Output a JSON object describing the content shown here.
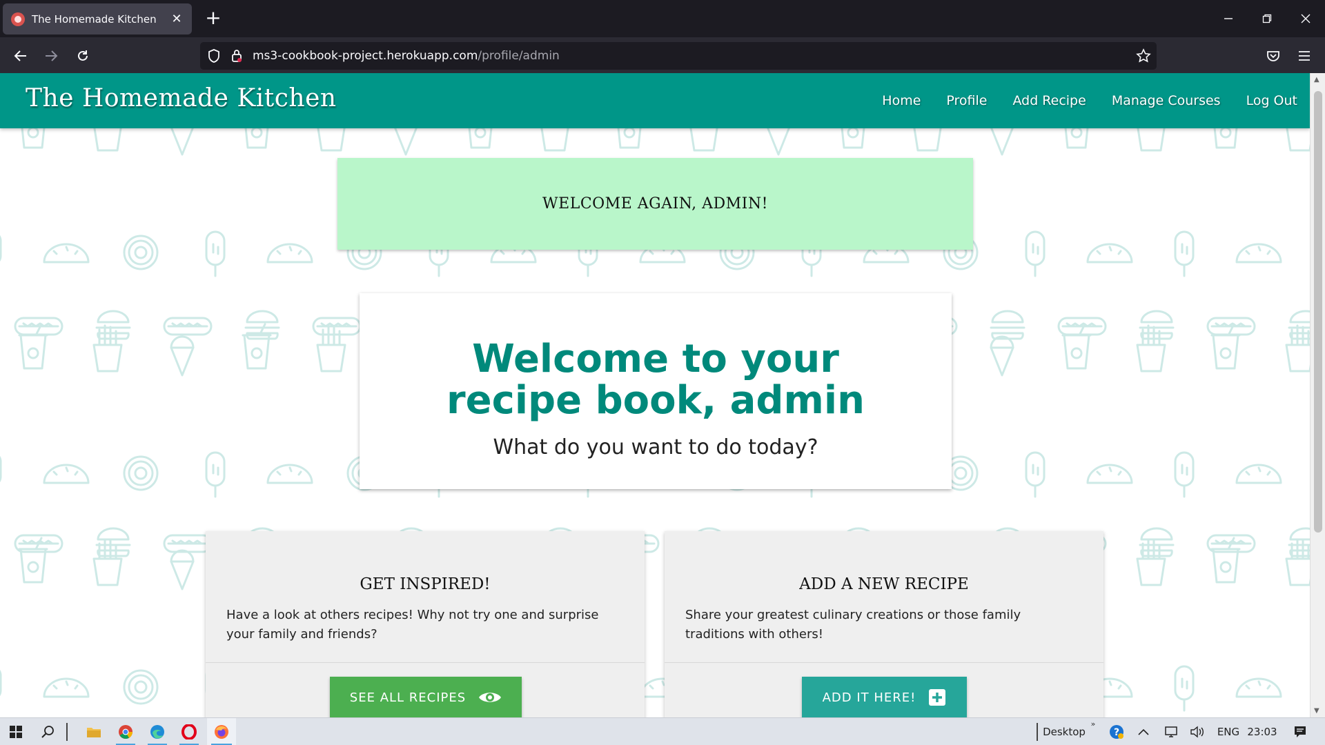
{
  "browser": {
    "tab_title": "The Homemade Kitchen",
    "url_host": "ms3-cookbook-project.herokuapp.com",
    "url_path": "/profile/admin"
  },
  "site": {
    "brand": "The Homemade Kitchen",
    "nav": [
      "Home",
      "Profile",
      "Add Recipe",
      "Manage Courses",
      "Log Out"
    ]
  },
  "flash_message": "WELCOME AGAIN, ADMIN!",
  "hero": {
    "title": "Welcome to your recipe book, admin",
    "subtitle": "What do you want to do today?"
  },
  "cards": [
    {
      "title": "GET INSPIRED!",
      "text": "Have a look at others recipes! Why not try one and surprise your family and friends?",
      "button": "SEE ALL RECIPES",
      "button_icon": "eye-icon",
      "button_color": "#4caf50"
    },
    {
      "title": "ADD A NEW RECIPE",
      "text": "Share your greatest culinary creations or those family traditions with others!",
      "button": "ADD IT HERE!",
      "button_icon": "plus-box-icon",
      "button_color": "#26a69a"
    }
  ],
  "taskbar": {
    "desktop_label": "Desktop",
    "language": "ENG",
    "time": "23:03"
  },
  "colors": {
    "header": "#009688",
    "flash": "#b9f6ca",
    "hero_title": "#00897b"
  }
}
